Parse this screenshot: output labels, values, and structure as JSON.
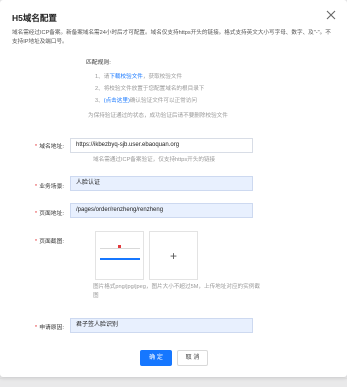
{
  "dialog": {
    "title": "H5域名配置",
    "notice": "域名需经过ICP备案。新备案域名需24小时后才可配置。域名仅支持https开头的链接。格式支持英文大小写字母、数字、及\"-\"。不支持IP地址及端口号。"
  },
  "verification": {
    "title": "匹配规则:",
    "step1": {
      "prefix": "1、请",
      "link": "下载校验文件",
      "suffix": "，获取校验文件"
    },
    "step2": {
      "text": "2、将校验文件放置于您配置域名的根目录下"
    },
    "step3": {
      "prefix": "3、",
      "link": "(点击这里)",
      "suffix": "确认验证文件可以正常访问"
    },
    "note": "为保持验证通过的状态，成功验证后请不要删除校验文件"
  },
  "form": {
    "domain": {
      "label": "域名地址:",
      "value": "https://ikbezbyq-sjb.user.ebaoquan.org",
      "hint": "域名需通过ICP备案验证，仅支持https开头的链接"
    },
    "scene": {
      "label": "业务场景:",
      "value": "人脸认证"
    },
    "page": {
      "label": "页面地址:",
      "value": "/pages/order/renzheng/renzheng"
    },
    "screenshot": {
      "label": "页面截图:",
      "add_icon": "+",
      "hint": "图片格式png/jpg/jpeg，图片大小不超过5M，上传地址对应的实例截图"
    },
    "reason": {
      "label": "申请原因:",
      "value": "君子签人脸识别"
    }
  },
  "buttons": {
    "confirm": "确 定",
    "cancel": "取 消"
  },
  "icons": {
    "close": "close-icon",
    "add": "plus-icon"
  },
  "colors": {
    "accent": "#1677ff",
    "required": "#e4393c",
    "filled_bg": "#e8f0fe"
  }
}
